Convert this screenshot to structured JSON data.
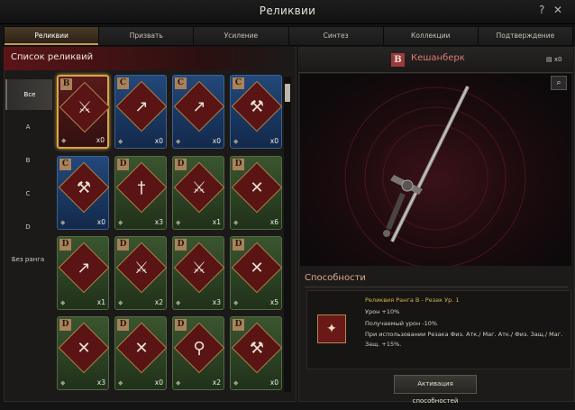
{
  "window": {
    "title": "Реликвии"
  },
  "tabs": [
    "Реликвии",
    "Призвать",
    "Усиление",
    "Синтез",
    "Коллекции",
    "Подтверждение"
  ],
  "list": {
    "title": "Список реликвий",
    "ranks": [
      "Все",
      "A",
      "B",
      "C",
      "D",
      "Без ранга"
    ],
    "cards": [
      {
        "grade": "B",
        "count": "x0",
        "icon": "halberd-icon"
      },
      {
        "grade": "C",
        "count": "x0",
        "icon": "spear-icon"
      },
      {
        "grade": "C",
        "count": "x0",
        "icon": "spear-icon"
      },
      {
        "grade": "C",
        "count": "x0",
        "icon": "axe-icon"
      },
      {
        "grade": "C",
        "count": "x0",
        "icon": "axe-icon"
      },
      {
        "grade": "D",
        "count": "x3",
        "icon": "dagger-icon"
      },
      {
        "grade": "D",
        "count": "x1",
        "icon": "sword-icon"
      },
      {
        "grade": "D",
        "count": "x6",
        "icon": "crossed-blades-icon"
      },
      {
        "grade": "D",
        "count": "x1",
        "icon": "spear-icon"
      },
      {
        "grade": "D",
        "count": "x2",
        "icon": "sword-icon"
      },
      {
        "grade": "D",
        "count": "x3",
        "icon": "sword-icon"
      },
      {
        "grade": "D",
        "count": "x5",
        "icon": "crossed-blades-icon"
      },
      {
        "grade": "D",
        "count": "x3",
        "icon": "crossed-blades-icon"
      },
      {
        "grade": "D",
        "count": "x0",
        "icon": "crossed-blades-icon"
      },
      {
        "grade": "D",
        "count": "x2",
        "icon": "mace-icon"
      },
      {
        "grade": "D",
        "count": "x0",
        "icon": "axe-icon"
      }
    ]
  },
  "detail": {
    "grade": "B",
    "name": "Кешанберк",
    "owned": "x0",
    "abilities_title": "Способности",
    "ability": {
      "name": "Реликвия Ранга B - Резак Ур. 1",
      "lines": [
        "Урон +10%",
        "Получаемый урон -10%",
        "При использовании Резака Физ. Атк./ Маг. Атк./ Физ. Защ./ Маг.",
        "Защ. +15%."
      ]
    },
    "activate_label": "Активация способностей"
  },
  "colors": {
    "accent": "#d6a548",
    "rank_b": "#a9825c",
    "name_red": "#e07a76"
  }
}
